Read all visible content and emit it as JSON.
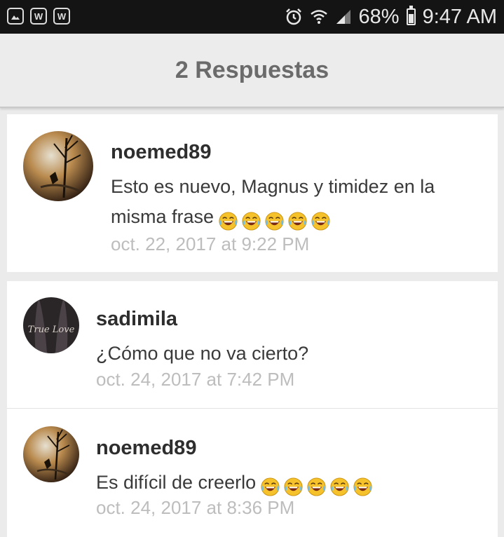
{
  "status_bar": {
    "left_icons": [
      "image-icon",
      "w-icon",
      "w-icon"
    ],
    "battery": "68%",
    "time": "9:47 AM"
  },
  "header": {
    "title": "2 Respuestas"
  },
  "comments": [
    {
      "username": "noemed89",
      "text": "Esto es nuevo, Magnus y timidez en la misma frase",
      "emoji_count": 5,
      "timestamp": "oct. 22, 2017 at 9:22 PM"
    },
    {
      "username": "sadimila",
      "avatar_text": "True Love",
      "text": "¿Cómo que no va cierto?",
      "timestamp": "oct. 24, 2017 at 7:42 PM"
    },
    {
      "username": "noemed89",
      "text": "Es difícil de creerlo",
      "emoji_count": 5,
      "timestamp": "oct. 24, 2017 at 8:36 PM"
    }
  ],
  "colors": {
    "header_bg": "#ececec",
    "title": "#6b6b6b",
    "timestamp": "#bdbdbd",
    "emoji": "#f6c22b"
  }
}
